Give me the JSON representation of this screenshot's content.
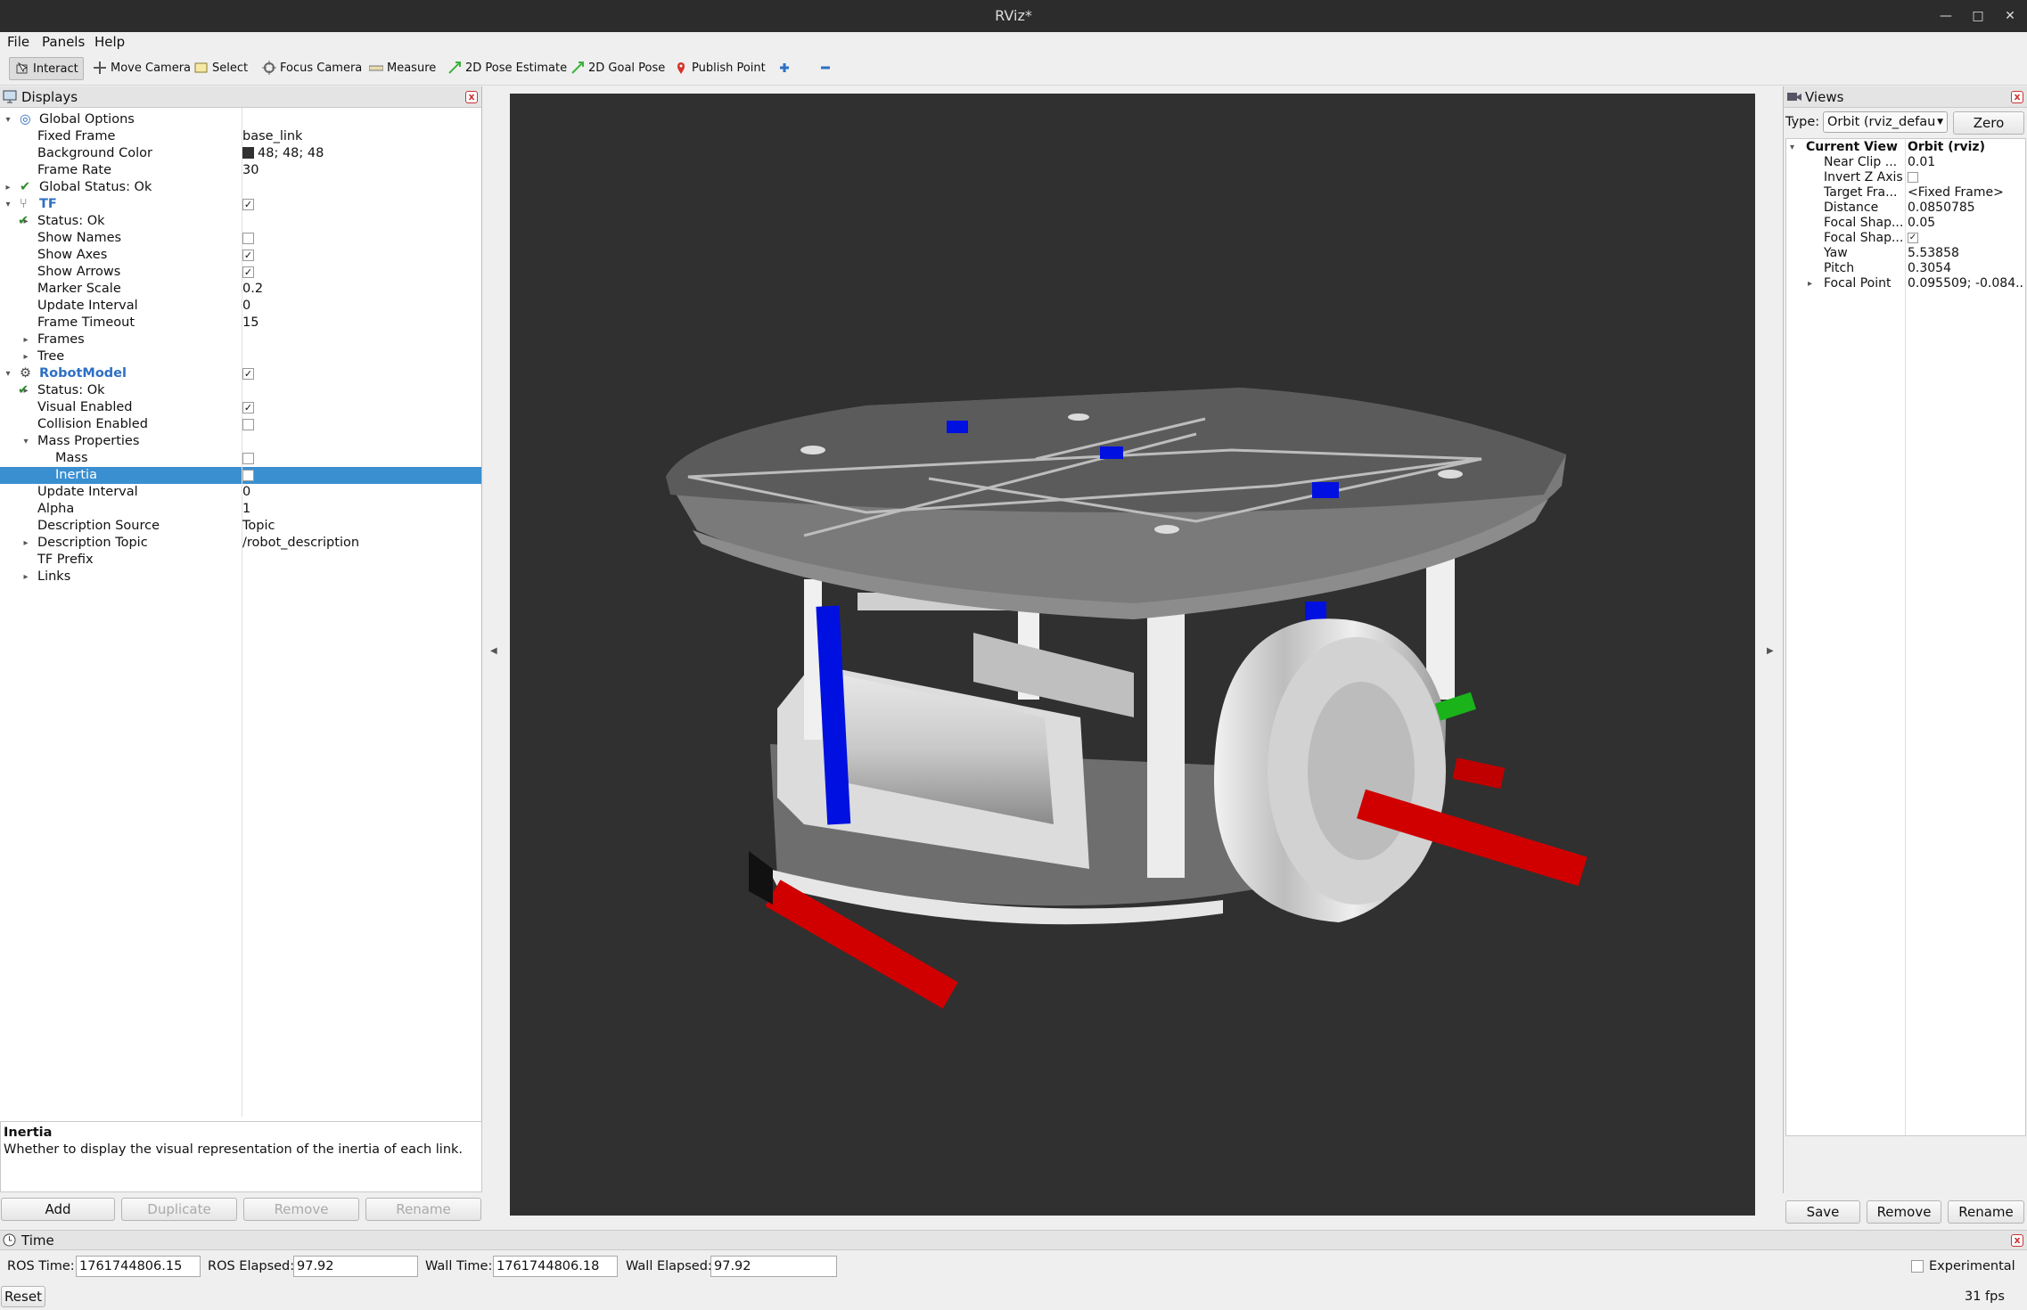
{
  "window": {
    "title": "RViz*"
  },
  "menu": [
    "File",
    "Panels",
    "Help"
  ],
  "toolbar": {
    "tools": [
      "Interact",
      "Move Camera",
      "Select",
      "Focus Camera",
      "Measure",
      "2D Pose Estimate",
      "2D Goal Pose",
      "Publish Point"
    ]
  },
  "displays": {
    "title": "Displays",
    "rows": [
      {
        "label": "Global Options",
        "value": ""
      },
      {
        "label": "Fixed Frame",
        "value": "base_link"
      },
      {
        "label": "Background Color",
        "value": "48; 48; 48"
      },
      {
        "label": "Frame Rate",
        "value": "30"
      },
      {
        "label": "Global Status: Ok",
        "value": ""
      },
      {
        "label": "TF",
        "value": ""
      },
      {
        "label": "Status: Ok",
        "value": ""
      },
      {
        "label": "Show Names",
        "value": ""
      },
      {
        "label": "Show Axes",
        "value": ""
      },
      {
        "label": "Show Arrows",
        "value": ""
      },
      {
        "label": "Marker Scale",
        "value": "0.2"
      },
      {
        "label": "Update Interval",
        "value": "0"
      },
      {
        "label": "Frame Timeout",
        "value": "15"
      },
      {
        "label": "Frames",
        "value": ""
      },
      {
        "label": "Tree",
        "value": ""
      },
      {
        "label": "RobotModel",
        "value": ""
      },
      {
        "label": "Status: Ok",
        "value": ""
      },
      {
        "label": "Visual Enabled",
        "value": ""
      },
      {
        "label": "Collision Enabled",
        "value": ""
      },
      {
        "label": "Mass Properties",
        "value": ""
      },
      {
        "label": "Mass",
        "value": ""
      },
      {
        "label": "Inertia",
        "value": ""
      },
      {
        "label": "Update Interval",
        "value": "0"
      },
      {
        "label": "Alpha",
        "value": "1"
      },
      {
        "label": "Description Source",
        "value": "Topic"
      },
      {
        "label": "Description Topic",
        "value": "/robot_description"
      },
      {
        "label": "TF Prefix",
        "value": ""
      },
      {
        "label": "Links",
        "value": ""
      }
    ],
    "checks": {
      "tf": true,
      "show_names": false,
      "show_axes": true,
      "show_arrows": true,
      "robotmodel": true,
      "visual_enabled": true,
      "collision_enabled": false,
      "mass": false,
      "inertia": false
    },
    "description": {
      "title": "Inertia",
      "text": "Whether to display the visual representation of the inertia of each link."
    },
    "buttons": [
      "Add",
      "Duplicate",
      "Remove",
      "Rename"
    ]
  },
  "views": {
    "title": "Views",
    "type_label": "Type:",
    "type_value": "Orbit (rviz_defau",
    "zero_label": "Zero",
    "rows": [
      {
        "label": "Current View",
        "value": "Orbit (rviz)"
      },
      {
        "label": "Near Clip ...",
        "value": "0.01"
      },
      {
        "label": "Invert Z Axis",
        "value": ""
      },
      {
        "label": "Target Fra...",
        "value": "<Fixed Frame>"
      },
      {
        "label": "Distance",
        "value": "0.0850785"
      },
      {
        "label": "Focal Shap...",
        "value": "0.05"
      },
      {
        "label": "Focal Shap...",
        "value": ""
      },
      {
        "label": "Yaw",
        "value": "5.53858"
      },
      {
        "label": "Pitch",
        "value": "0.3054"
      },
      {
        "label": "Focal Point",
        "value": "0.095509; -0.084..."
      }
    ],
    "invert_z": false,
    "focal_shape_fixed": true,
    "buttons": [
      "Save",
      "Remove",
      "Rename"
    ]
  },
  "time": {
    "title": "Time",
    "ros_time_label": "ROS Time:",
    "ros_time": "1761744806.15",
    "ros_elapsed_label": "ROS Elapsed:",
    "ros_elapsed": "97.92",
    "wall_time_label": "Wall Time:",
    "wall_time": "1761744806.18",
    "wall_elapsed_label": "Wall Elapsed:",
    "wall_elapsed": "97.92",
    "experimental_label": "Experimental",
    "reset_label": "Reset",
    "fps": "31 fps"
  },
  "colors": {
    "background": "#303030",
    "selection": "#3a8fd1",
    "accent": "#2e6fc4"
  }
}
